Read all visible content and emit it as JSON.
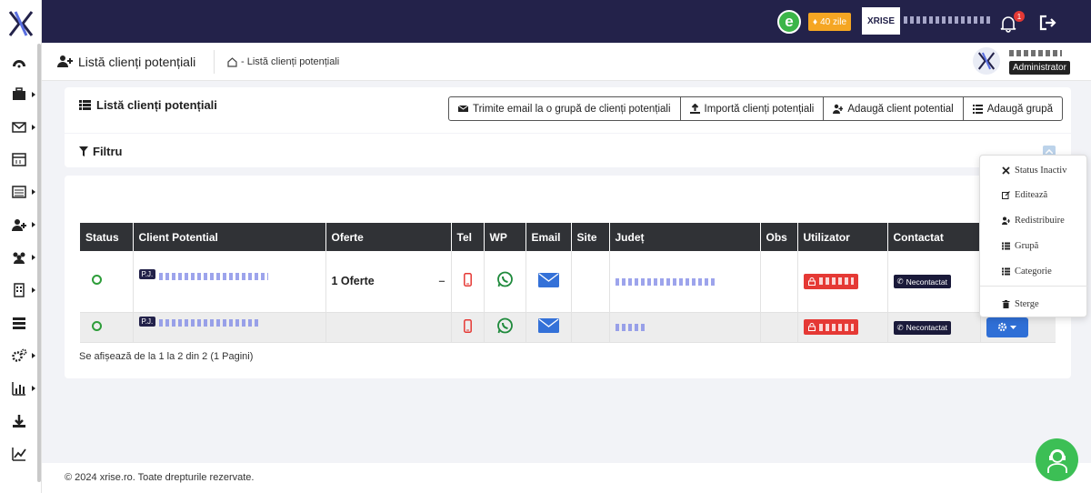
{
  "topbar": {
    "trial_badge": "40 zile",
    "brand_name": "XRISE",
    "notification_count": "1"
  },
  "header": {
    "page_title": "Listă clienți potențiali",
    "breadcrumb": "Listă clienți potențiali",
    "user_role": "Administrator"
  },
  "card": {
    "title": "Listă clienți potențiali",
    "buttons": [
      "Trimite email la o grupă de clienți potențiali",
      "Importă clienți potențiali",
      "Adaugă client potential",
      "Adaugă grupă"
    ],
    "filter_label": "Filtru"
  },
  "table": {
    "headers": [
      "Status",
      "Client Potential",
      "Oferte",
      "Tel",
      "WP",
      "Email",
      "Site",
      "Județ",
      "Obs",
      "Utilizator",
      "Contactat",
      ""
    ],
    "rows": [
      {
        "client_tag": "P.J.",
        "offers": "1 Oferte",
        "offer_dash": "–",
        "contact_status": "Necontactat"
      },
      {
        "client_tag": "P.J.",
        "offers": "",
        "offer_dash": "",
        "contact_status": "Necontactat"
      }
    ],
    "pagination_info": "Se afișează de la 1 la 2 din 2 (1 Pagini)"
  },
  "dropdown": {
    "items": [
      "Status Inactiv",
      "Editează",
      "Redistribuire",
      "Grupă",
      "Categorie",
      "Sterge"
    ]
  },
  "footer": {
    "copyright": "© 2024 xrise.ro. Toate drepturile rezervate."
  },
  "colors": {
    "topbar": "#23224a",
    "status_green": "#2e9d3a",
    "danger_red": "#e53935",
    "primary_blue": "#2f6fd6",
    "trial_orange": "#f5a623"
  }
}
